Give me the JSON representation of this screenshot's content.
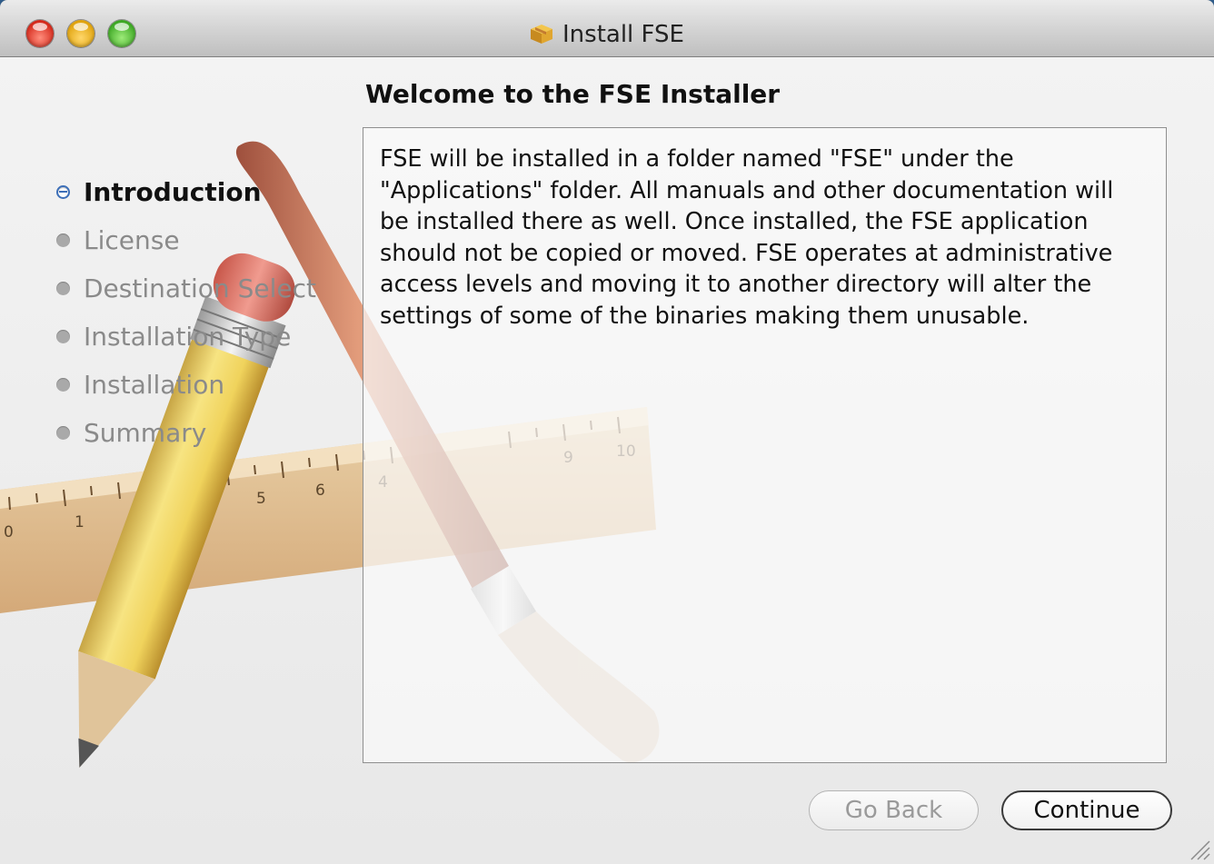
{
  "window": {
    "title": "Install FSE",
    "controls": [
      "close",
      "minimize",
      "zoom"
    ],
    "title_icon": "package-icon"
  },
  "main": {
    "heading": "Welcome to the FSE Installer",
    "body": "FSE will be installed in a folder named \"FSE\" under the \"Applications\" folder. All manuals and other documentation will be installed there as well. Once installed, the FSE application should not be copied or moved. FSE operates at administrative access levels and moving it to another directory will alter the settings of some of the binaries making them unusable."
  },
  "steps": [
    {
      "label": "Introduction",
      "active": true
    },
    {
      "label": "License",
      "active": false
    },
    {
      "label": "Destination Select",
      "active": false
    },
    {
      "label": "Installation Type",
      "active": false
    },
    {
      "label": "Installation",
      "active": false
    },
    {
      "label": "Summary",
      "active": false
    }
  ],
  "buttons": {
    "back": "Go Back",
    "continue": "Continue"
  },
  "ruler_numbers": [
    "0",
    "1",
    "4",
    "5",
    "6",
    "9",
    "10"
  ],
  "colors": {
    "active_step_bullet": "#3d6fb8",
    "pending_step_text": "#8a8a8a"
  }
}
